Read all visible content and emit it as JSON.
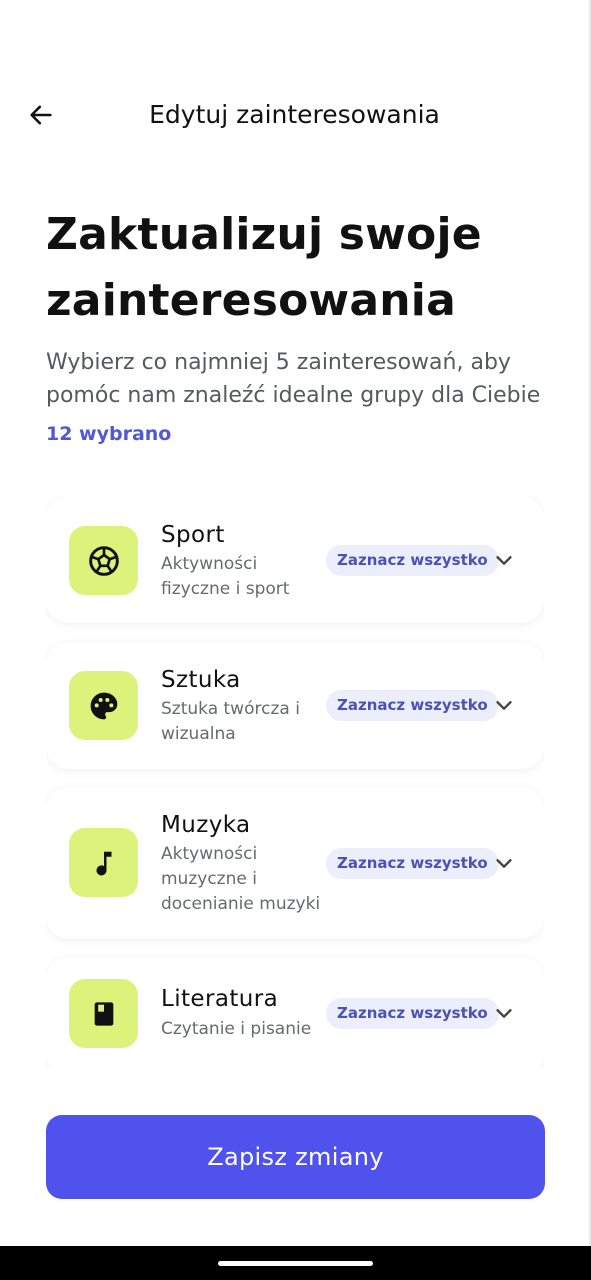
{
  "header": {
    "title": "Edytuj zainteresowania",
    "back_icon": "arrow-left-icon"
  },
  "main": {
    "headline": "Zaktualizuj swoje zainteresowania",
    "subtitle": "Wybierz co najmniej 5 zainteresowań, aby pomóc nam znaleźć idealne grupy dla Ciebie",
    "selected_count": "12 wybrano"
  },
  "categories": [
    {
      "name": "Sport",
      "description": "Aktywności fizyczne i sport",
      "icon": "soccer-ball-icon",
      "select_all_label": "Zaznacz wszystko"
    },
    {
      "name": "Sztuka",
      "description": "Sztuka twórcza i wizualna",
      "icon": "palette-icon",
      "select_all_label": "Zaznacz wszystko"
    },
    {
      "name": "Muzyka",
      "description": "Aktywności muzyczne i docenianie muzyki",
      "icon": "music-note-icon",
      "select_all_label": "Zaznacz wszystko"
    },
    {
      "name": "Literatura",
      "description": "Czytanie i pisanie",
      "icon": "book-icon",
      "select_all_label": "Zaznacz wszystko"
    }
  ],
  "footer": {
    "save_label": "Zapisz zmiany"
  },
  "colors": {
    "accent": "#5052ee",
    "icon_tile": "#dcf27a",
    "chip_bg": "#eceefb",
    "chip_text": "#4a52b8"
  }
}
